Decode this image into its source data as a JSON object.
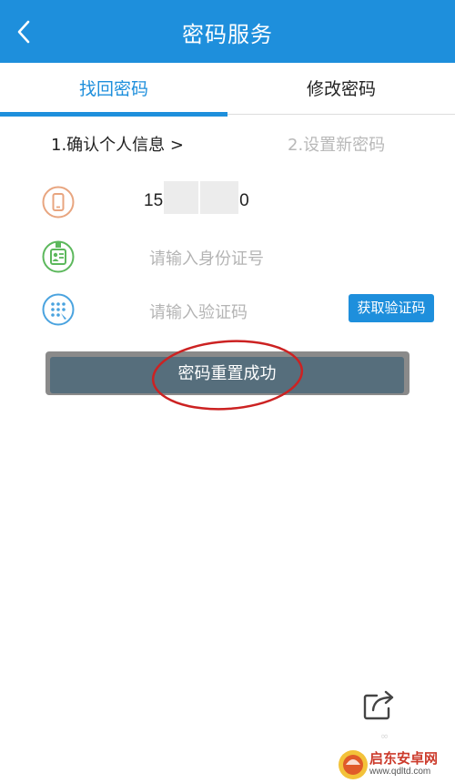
{
  "header": {
    "title": "密码服务",
    "back_icon": "chevron-left-icon"
  },
  "tabs": [
    {
      "label": "找回密码",
      "active": true
    },
    {
      "label": "修改密码",
      "active": false
    }
  ],
  "steps": {
    "step1": "1.确认个人信息 >",
    "step2": "2.设置新密码"
  },
  "form": {
    "phone_prefix": "15",
    "phone_suffix": "0",
    "id_placeholder": "请输入身份证号",
    "code_placeholder": "请输入验证码",
    "get_code_label": "获取验证码"
  },
  "toast": {
    "message": "密码重置成功"
  },
  "watermark": {
    "brand": "启东安卓网",
    "url": "www.qdltd.com"
  },
  "colors": {
    "accent": "#1e8fdc",
    "phone_icon": "#e8a57f",
    "id_icon": "#5cb85c",
    "code_icon": "#4aa3df",
    "toast_bg": "#566e7c",
    "annotation": "#cc2222"
  }
}
